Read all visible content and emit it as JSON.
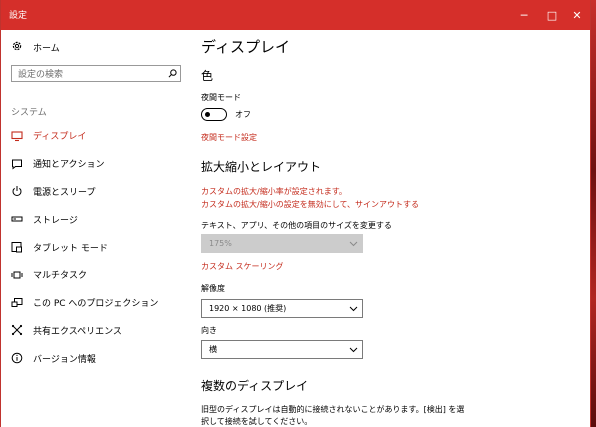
{
  "window": {
    "title": "設定"
  },
  "controls": {
    "minimize": "─",
    "maximize": "□",
    "close": "✕"
  },
  "sidebar": {
    "home": "ホーム",
    "search_placeholder": "設定の検索",
    "section": "システム",
    "items": [
      {
        "label": "ディスプレイ",
        "icon": "monitor-icon",
        "active": true
      },
      {
        "label": "通知とアクション",
        "icon": "message-icon",
        "active": false
      },
      {
        "label": "電源とスリープ",
        "icon": "power-icon",
        "active": false
      },
      {
        "label": "ストレージ",
        "icon": "storage-icon",
        "active": false
      },
      {
        "label": "タブレット モード",
        "icon": "tablet-icon",
        "active": false
      },
      {
        "label": "マルチタスク",
        "icon": "multitask-icon",
        "active": false
      },
      {
        "label": "この PC へのプロジェクション",
        "icon": "projection-icon",
        "active": false
      },
      {
        "label": "共有エクスペリエンス",
        "icon": "shared-experiences-icon",
        "active": false
      },
      {
        "label": "バージョン情報",
        "icon": "info-icon",
        "active": false
      }
    ]
  },
  "main": {
    "title": "ディスプレイ",
    "color_heading": "色",
    "night_mode_label": "夜間モード",
    "night_mode_state": "オフ",
    "night_mode_link": "夜間モード設定",
    "scale_heading": "拡大縮小とレイアウト",
    "scale_warning_1": "カスタムの拡大/縮小率が設定されます。",
    "scale_warning_2": "カスタムの拡大/縮小の設定を無効にして、サインアウトする",
    "scale_label": "テキスト、アプリ、その他の項目のサイズを変更する",
    "scale_value": "175%",
    "custom_scaling_link": "カスタム スケーリング",
    "resolution_label": "解像度",
    "resolution_value": "1920 × 1080 (推奨)",
    "orientation_label": "向き",
    "orientation_value": "横",
    "multi_display_heading": "複数のディスプレイ",
    "multi_display_desc": "旧型のディスプレイは自動的に接続されないことがあります。[検出] を選択して接続を試してください。"
  },
  "colors": {
    "accent": "#c42b1c",
    "titlebar": "#d52f2a"
  }
}
